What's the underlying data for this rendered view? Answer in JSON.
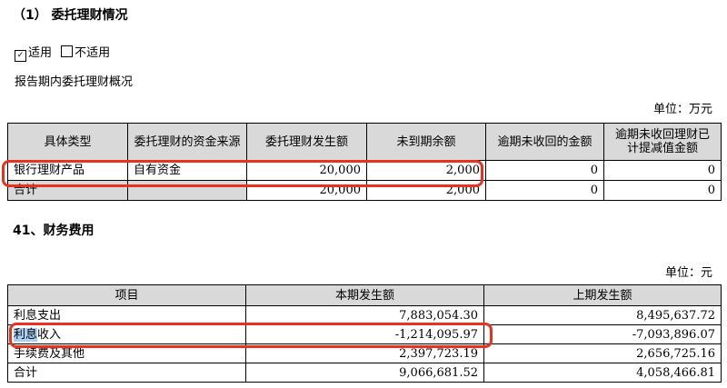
{
  "section_title": "（1） 委托理财情况",
  "applicability": {
    "applicable_label": "适用",
    "not_applicable_label": "不适用",
    "check_mark": "✓"
  },
  "overview_text": "报告期内委托理财概况",
  "unit1": "单位：万元",
  "table1": {
    "headers": [
      "具体类型",
      "委托理财的资金来源",
      "委托理财发生额",
      "未到期余额",
      "逾期未收回的金额",
      "逾期未收回理财已计提减值金额"
    ],
    "rows": [
      [
        "银行理财产品",
        "自有资金",
        "20,000",
        "2,000",
        "0",
        "0"
      ],
      [
        "合计",
        "",
        "20,000",
        "2,000",
        "0",
        "0"
      ]
    ]
  },
  "section2_title": "41、财务费用",
  "unit2": "单位：元",
  "table2": {
    "headers": [
      "项目",
      "本期发生额",
      "上期发生额"
    ],
    "rows": [
      [
        "利息支出",
        "7,883,054.30",
        "8,495,637.72"
      ],
      [
        "利息收入",
        "-1,214,095.97",
        "-7,093,896.07"
      ],
      [
        "手续费及其他",
        "2,397,723.19",
        "2,656,725.16"
      ],
      [
        "合计",
        "9,066,681.52",
        "4,058,466.81"
      ]
    ],
    "highlighted_fragment": "利息",
    "highlighted_rest": "收入"
  },
  "highlight_color": "#e8321e"
}
